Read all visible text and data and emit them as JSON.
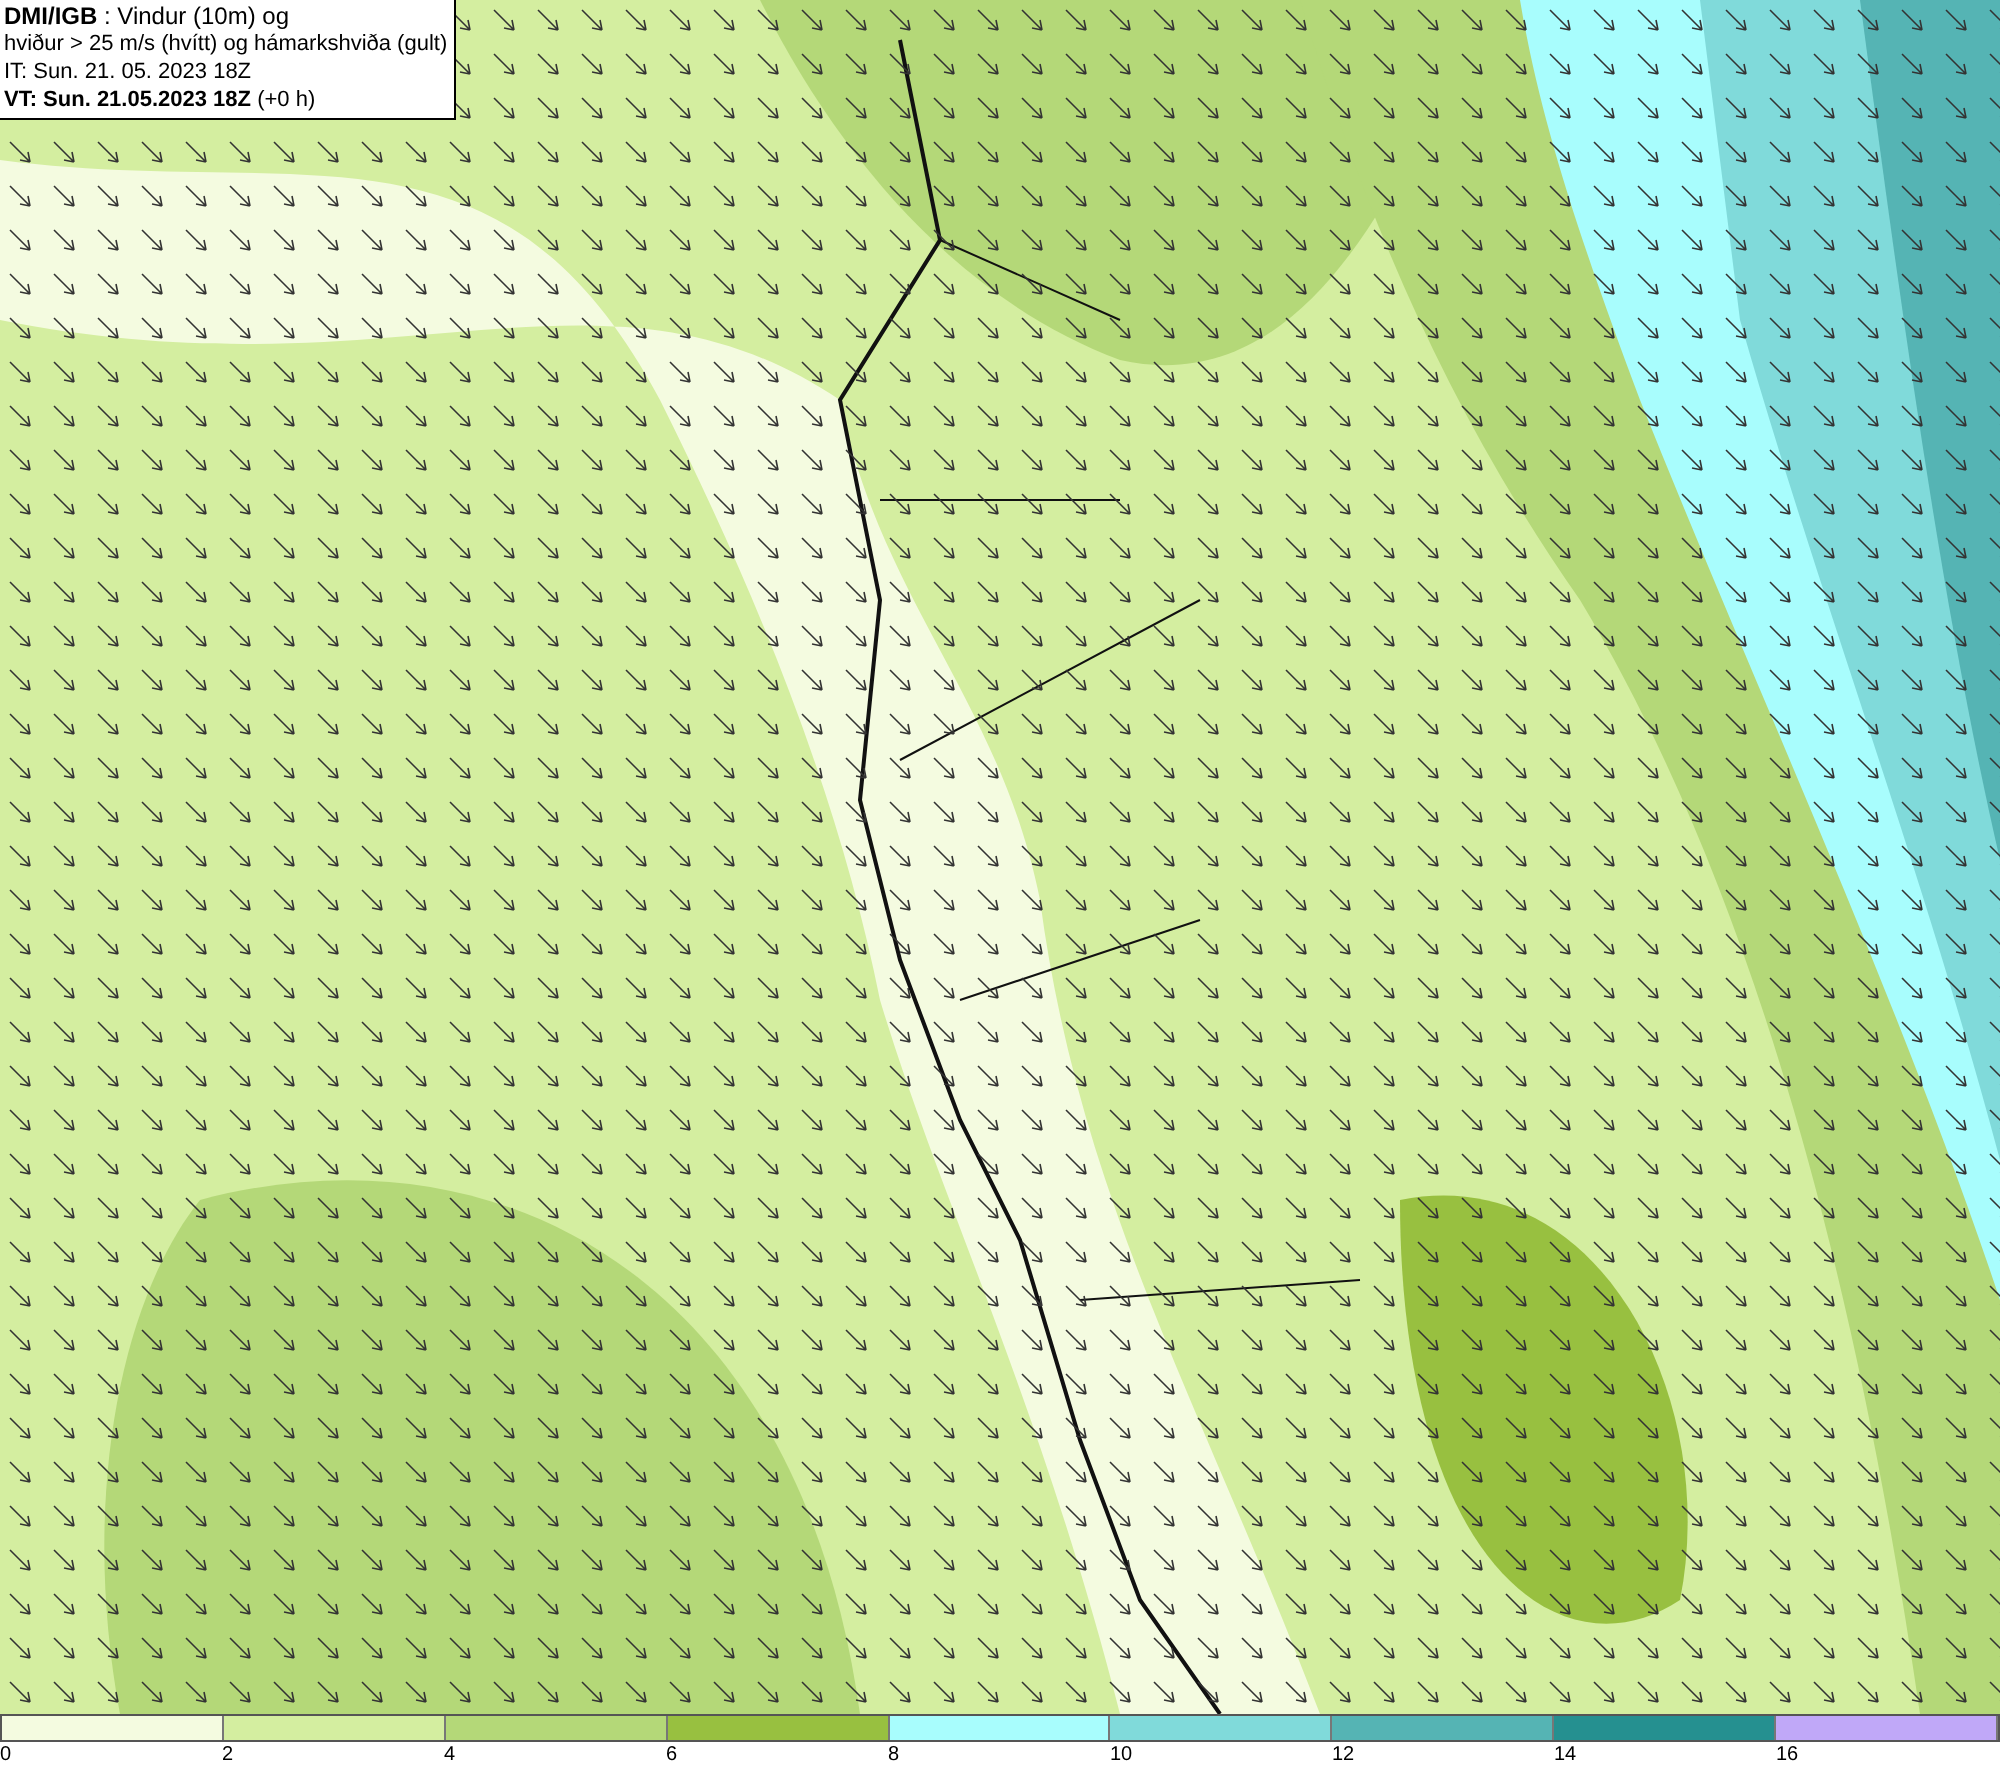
{
  "header": {
    "lines": [
      "**DMI/IGB** : Vindur (10m) og",
      "hviður > 25 m/s (hvítt) og hámarkshviða (gult)",
      "IT: Sun. 21. 05. 2023 18Z",
      "**VT: Sun. 21.05.2023 18Z** (+0 h)"
    ]
  },
  "legend": {
    "swatches": [
      {
        "color": "#f4fbe0"
      },
      {
        "color": "#d4eea0"
      },
      {
        "color": "#b4d878"
      },
      {
        "color": "#98c040"
      },
      {
        "color": "#a8fdfd"
      },
      {
        "color": "#80dada"
      },
      {
        "color": "#55b4b4"
      },
      {
        "color": "#259090"
      },
      {
        "color": "#c0a8f8"
      }
    ],
    "ticks": [
      "0",
      "2",
      "4",
      "6",
      "8",
      "10",
      "12",
      "14",
      "16"
    ]
  }
}
